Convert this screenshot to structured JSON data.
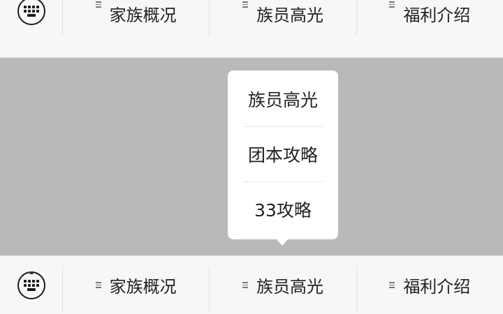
{
  "top_menu": {
    "items": [
      {
        "label": "家族概况",
        "icon": "menu-lines-icon"
      },
      {
        "label": "族员高光",
        "icon": "menu-lines-icon"
      },
      {
        "label": "福利介绍",
        "icon": "menu-lines-icon"
      }
    ],
    "keyboard_icon": "keyboard-icon"
  },
  "popup": {
    "items": [
      {
        "label": "族员高光"
      },
      {
        "label": "团本攻略"
      },
      {
        "label": "33攻略"
      }
    ]
  },
  "bottom_menu": {
    "items": [
      {
        "label": "家族概况",
        "icon": "menu-lines-icon"
      },
      {
        "label": "族员高光",
        "icon": "menu-lines-icon"
      },
      {
        "label": "福利介绍",
        "icon": "menu-lines-icon"
      }
    ],
    "keyboard_icon": "keyboard-icon"
  },
  "colors": {
    "overlay": "#b9b9b9",
    "menubar_bg": "#f7f7f7",
    "popup_bg": "#ffffff",
    "text": "#222222"
  }
}
